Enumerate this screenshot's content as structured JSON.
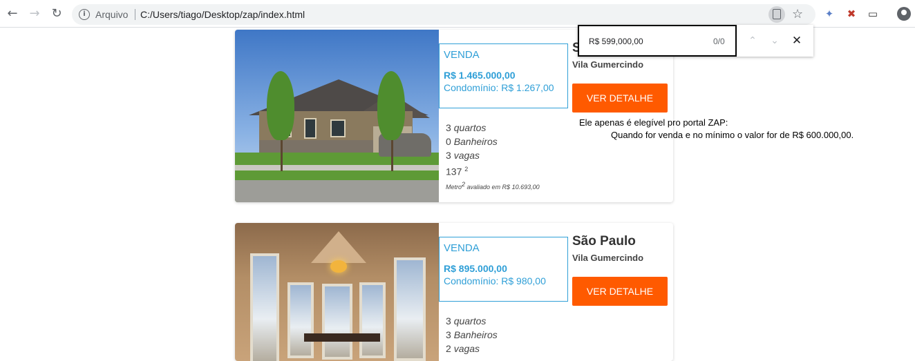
{
  "browser": {
    "back_icon": "arrow-left-icon",
    "forward_icon": "arrow-right-icon",
    "reload_icon": "reload-icon",
    "scheme_label": "Arquivo",
    "url": "C:/Users/tiago/Desktop/zap/index.html"
  },
  "find_bar": {
    "query": "R$ 599,000,00",
    "count": "0/0"
  },
  "listings": [
    {
      "transaction": "VENDA",
      "price": "R$ 1.465.000,00",
      "condo": "Condomínio: R$ 1.267,00",
      "city": "S",
      "neighborhood": "Vila Gumercindo",
      "button": "VER DETALHE",
      "bedrooms_num": "3",
      "bedrooms_label": "quartos",
      "bathrooms_num": "0",
      "bathrooms_label": "Banheiros",
      "parking_num": "3",
      "parking_label": "vagas",
      "area": "137",
      "area_sup": "2",
      "area_note_pre": "Metro",
      "area_note_sup": "2",
      "area_note_post": " avaliado em R$ 10.693,00"
    },
    {
      "transaction": "VENDA",
      "price": "R$ 895.000,00",
      "condo": "Condomínio: R$ 980,00",
      "city": "São Paulo",
      "neighborhood": "Vila Gumercindo",
      "button": "VER DETALHE",
      "bedrooms_num": "3",
      "bedrooms_label": "quartos",
      "bathrooms_num": "3",
      "bathrooms_label": "Banheiros",
      "parking_num": "2",
      "parking_label": "vagas"
    }
  ],
  "note": {
    "line1": "Ele apenas é elegível pro portal ZAP:",
    "line2": "Quando for venda e no mínimo o valor for de R$ 600.000,00."
  },
  "colors": {
    "accent_blue": "#2f9fd7",
    "button_orange": "#ff5a00"
  }
}
